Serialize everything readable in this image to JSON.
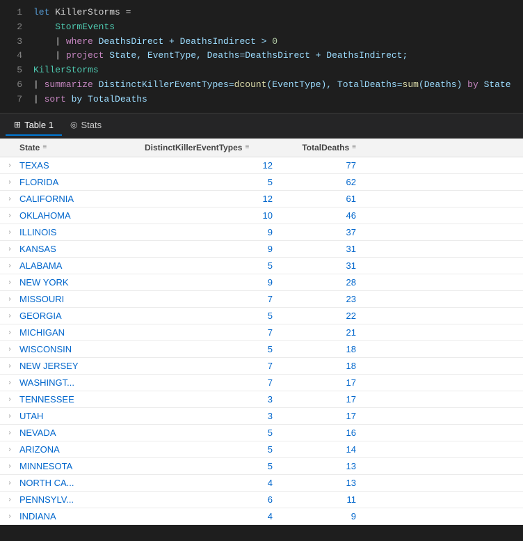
{
  "code": {
    "lines": [
      {
        "number": 1,
        "parts": [
          {
            "text": "let",
            "cls": "kw-let"
          },
          {
            "text": " KillerStorms =",
            "cls": "op"
          }
        ]
      },
      {
        "number": 2,
        "parts": [
          {
            "text": "    StormEvents",
            "cls": "identifier"
          }
        ]
      },
      {
        "number": 3,
        "parts": [
          {
            "text": "    | ",
            "cls": "kw-pipe"
          },
          {
            "text": "where",
            "cls": "kw-where"
          },
          {
            "text": " DeathsDirect + DeathsIndirect > ",
            "cls": "param"
          },
          {
            "text": "0",
            "cls": "num"
          }
        ]
      },
      {
        "number": 4,
        "parts": [
          {
            "text": "    | ",
            "cls": "kw-pipe"
          },
          {
            "text": "project",
            "cls": "kw-project"
          },
          {
            "text": " State, EventType, Deaths=DeathsDirect + DeathsIndirect;",
            "cls": "param"
          }
        ]
      },
      {
        "number": 5,
        "parts": [
          {
            "text": "KillerStorms",
            "cls": "identifier"
          }
        ]
      },
      {
        "number": 6,
        "parts": [
          {
            "text": "| ",
            "cls": "kw-pipe"
          },
          {
            "text": "summarize",
            "cls": "kw-summarize"
          },
          {
            "text": " DistinctKillerEventTypes=",
            "cls": "param"
          },
          {
            "text": "dcount",
            "cls": "fn-name"
          },
          {
            "text": "(EventType), TotalDeaths=",
            "cls": "param"
          },
          {
            "text": "sum",
            "cls": "fn-name"
          },
          {
            "text": "(Deaths) ",
            "cls": "param"
          },
          {
            "text": "by",
            "cls": "kw-by"
          },
          {
            "text": " State",
            "cls": "param"
          }
        ]
      },
      {
        "number": 7,
        "parts": [
          {
            "text": "| ",
            "cls": "kw-pipe"
          },
          {
            "text": "sort",
            "cls": "kw-sort"
          },
          {
            "text": " by TotalDeaths",
            "cls": "param"
          }
        ]
      }
    ]
  },
  "tabs": [
    {
      "label": "Table 1",
      "icon": "⊞",
      "active": true
    },
    {
      "label": "Stats",
      "icon": "◎",
      "active": false
    }
  ],
  "table": {
    "columns": [
      {
        "label": "State",
        "key": "state"
      },
      {
        "label": "DistinctKillerEventTypes",
        "key": "distinct"
      },
      {
        "label": "TotalDeaths",
        "key": "total"
      }
    ],
    "rows": [
      {
        "state": "TEXAS",
        "distinct": 12,
        "total": 77
      },
      {
        "state": "FLORIDA",
        "distinct": 5,
        "total": 62
      },
      {
        "state": "CALIFORNIA",
        "distinct": 12,
        "total": 61
      },
      {
        "state": "OKLAHOMA",
        "distinct": 10,
        "total": 46
      },
      {
        "state": "ILLINOIS",
        "distinct": 9,
        "total": 37
      },
      {
        "state": "KANSAS",
        "distinct": 9,
        "total": 31
      },
      {
        "state": "ALABAMA",
        "distinct": 5,
        "total": 31
      },
      {
        "state": "NEW YORK",
        "distinct": 9,
        "total": 28
      },
      {
        "state": "MISSOURI",
        "distinct": 7,
        "total": 23
      },
      {
        "state": "GEORGIA",
        "distinct": 5,
        "total": 22
      },
      {
        "state": "MICHIGAN",
        "distinct": 7,
        "total": 21
      },
      {
        "state": "WISCONSIN",
        "distinct": 5,
        "total": 18
      },
      {
        "state": "NEW JERSEY",
        "distinct": 7,
        "total": 18
      },
      {
        "state": "WASHINGT...",
        "distinct": 7,
        "total": 17
      },
      {
        "state": "TENNESSEE",
        "distinct": 3,
        "total": 17
      },
      {
        "state": "UTAH",
        "distinct": 3,
        "total": 17
      },
      {
        "state": "NEVADA",
        "distinct": 5,
        "total": 16
      },
      {
        "state": "ARIZONA",
        "distinct": 5,
        "total": 14
      },
      {
        "state": "MINNESOTA",
        "distinct": 5,
        "total": 13
      },
      {
        "state": "NORTH CA...",
        "distinct": 4,
        "total": 13
      },
      {
        "state": "PENNSYLV...",
        "distinct": 6,
        "total": 11
      },
      {
        "state": "INDIANA",
        "distinct": 4,
        "total": 9
      }
    ]
  }
}
